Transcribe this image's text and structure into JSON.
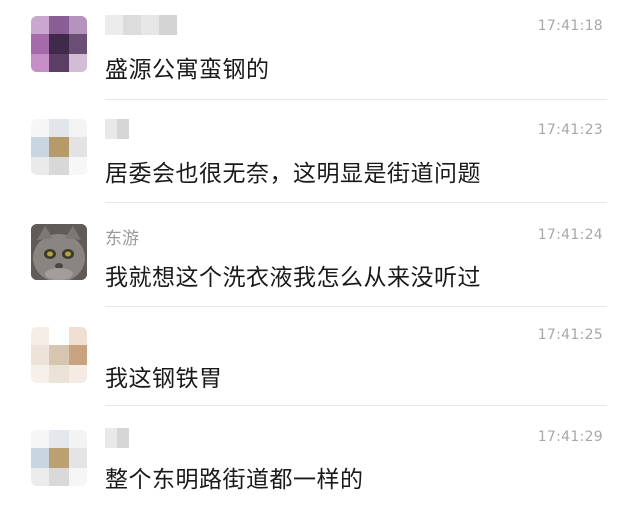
{
  "messages": [
    {
      "name": "",
      "time": "17:41:18",
      "text": "盛源公寓蛮钢的",
      "avatar_icon": "user-avatar-blurred"
    },
    {
      "name": "",
      "time": "17:41:23",
      "text": "居委会也很无奈，这明显是街道问题",
      "avatar_icon": "user-avatar-blurred"
    },
    {
      "name": "东游",
      "time": "17:41:24",
      "text": "我就想这个洗衣液我怎么从来没听过",
      "avatar_icon": "cat-avatar"
    },
    {
      "name": "",
      "time": "17:41:25",
      "text": "我这钢铁胃",
      "avatar_icon": "user-avatar-blurred"
    },
    {
      "name": "",
      "time": "17:41:29",
      "text": "整个东明路街道都一样的",
      "avatar_icon": "user-avatar-blurred"
    }
  ]
}
